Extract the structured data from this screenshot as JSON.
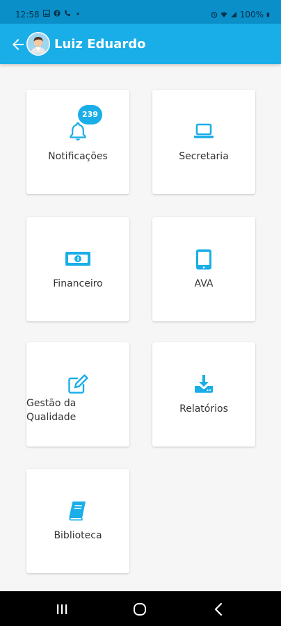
{
  "status_bar": {
    "time": "12:58",
    "battery": "100%",
    "left_icons": [
      "image-icon",
      "facebook-icon",
      "phone-icon",
      "dot-icon"
    ],
    "right_icons": [
      "alarm-icon",
      "wifi-icon",
      "signal-icon",
      "battery-icon"
    ]
  },
  "header": {
    "title": "Luiz Eduardo",
    "back_icon": "arrow-left-icon",
    "avatar_icon": "user-avatar"
  },
  "colors": {
    "status_bar": "#0a8fc9",
    "app_bar": "#1aaee8",
    "icon": "#1aaee8",
    "background": "#f6f6f6",
    "card": "#ffffff",
    "text": "#333333"
  },
  "menu": {
    "cards": [
      {
        "label": "Notificações",
        "icon": "bell-icon",
        "badge": "239"
      },
      {
        "label": "Secretaria",
        "icon": "laptop-icon"
      },
      {
        "label": "Financeiro",
        "icon": "money-icon"
      },
      {
        "label": "AVA",
        "icon": "tablet-icon"
      },
      {
        "label_line1": "Gestão da",
        "label_line2": "Qualidade",
        "icon": "edit-icon"
      },
      {
        "label": "Relatórios",
        "icon": "download-icon"
      },
      {
        "label": "Biblioteca",
        "icon": "book-icon"
      }
    ]
  },
  "nav_bar": {
    "buttons": [
      "recent-apps-icon",
      "home-icon",
      "back-icon"
    ]
  }
}
